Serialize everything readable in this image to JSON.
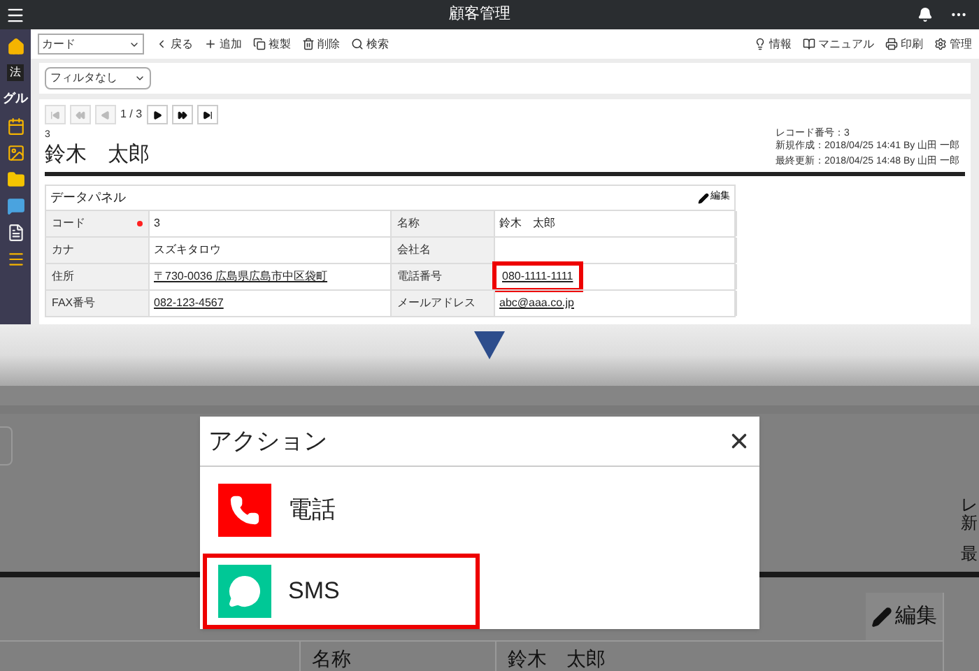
{
  "window": {
    "title": "顧客管理"
  },
  "sidebar": {
    "labels": [
      "法",
      "グル"
    ]
  },
  "toolbar": {
    "view_select": "カード",
    "actions": [
      "戻る",
      "追加",
      "複製",
      "削除",
      "検索"
    ],
    "right_actions": [
      "情報",
      "マニュアル",
      "印刷",
      "管理"
    ]
  },
  "filter": {
    "value": "フィルタなし"
  },
  "pager": {
    "position": "1 / 3",
    "buttons": [
      {
        "disabled": true
      },
      {
        "disabled": true
      },
      {
        "disabled": true
      },
      {
        "disabled": false
      },
      {
        "disabled": false
      },
      {
        "disabled": false
      }
    ]
  },
  "record": {
    "id": "3",
    "name": "鈴木　太郎",
    "meta": [
      "レコード番号：3",
      "新規作成：2018/04/25 14:41 By 山田 一郎",
      "最終更新：2018/04/25 14:48 By 山田 一郎"
    ]
  },
  "panel": {
    "title": "データパネル",
    "edit": "編集",
    "rows": [
      {
        "cells": [
          {
            "label": "コード",
            "required": true,
            "value": "3",
            "link": false,
            "highlighted": false
          },
          {
            "label": "名称",
            "required": false,
            "value": "鈴木　太郎",
            "link": false,
            "highlighted": false
          }
        ]
      },
      {
        "cells": [
          {
            "label": "カナ",
            "required": false,
            "value": "スズキタロウ",
            "link": false,
            "highlighted": false
          },
          {
            "label": "会社名",
            "required": false
          }
        ]
      },
      {
        "cells": [
          {
            "label": "住所",
            "required": false,
            "value": "〒730-0036 広島県広島市中区袋町",
            "link": true,
            "highlighted": false
          },
          {
            "label": "電話番号",
            "required": false,
            "value": "080-1111-1111",
            "link": true,
            "highlighted": true
          }
        ]
      },
      {
        "cells": [
          {
            "label": "FAX番号",
            "required": false,
            "value": "082-123-4567",
            "link": true,
            "highlighted": false
          },
          {
            "label": "メールアドレス",
            "required": false,
            "value": "abc@aaa.co.jp",
            "link": true,
            "highlighted": false
          }
        ]
      }
    ]
  },
  "zoomed": {
    "edge_texts": [
      "レ",
      "新",
      "最"
    ],
    "edit": "編集",
    "label": "名称",
    "value": "鈴木　太郎"
  },
  "dialog": {
    "title": "アクション",
    "actions": [
      {
        "kind": "phone",
        "label": "電話",
        "highlighted": false
      },
      {
        "kind": "sms",
        "label": "SMS",
        "highlighted": true
      }
    ]
  }
}
